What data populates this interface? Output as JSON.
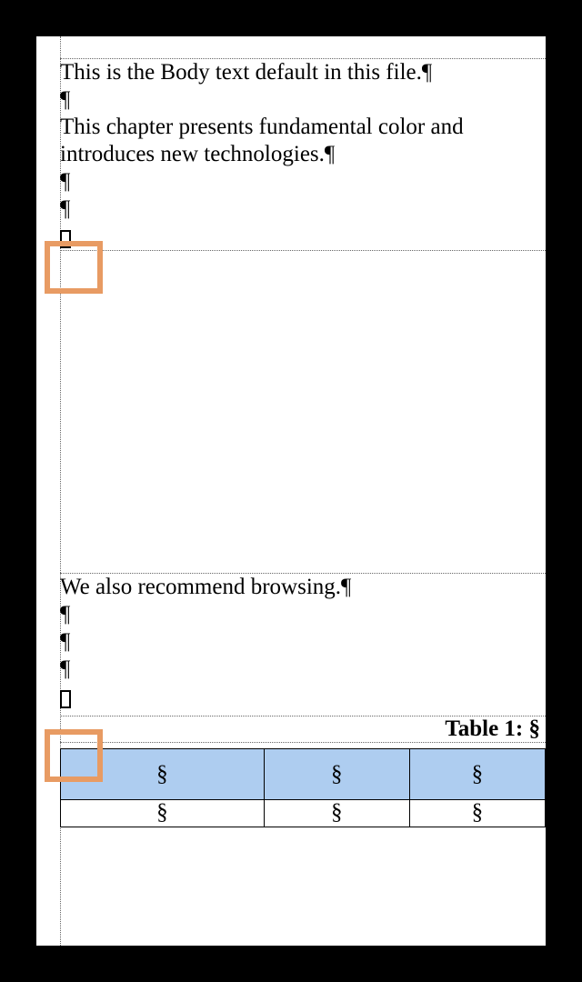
{
  "document": {
    "block1": {
      "line1": "This is the Body text default in this file.¶",
      "empty": "¶",
      "line2": "This chapter presents fundamental color and introduces new technologies.¶"
    },
    "block2": {
      "line1": "We also recommend browsing.¶",
      "empty": "¶"
    },
    "table": {
      "caption": "Table 1: §",
      "cell_mark": "§"
    },
    "marks": {
      "pilcrow": "¶",
      "anchor": "⎕"
    }
  }
}
